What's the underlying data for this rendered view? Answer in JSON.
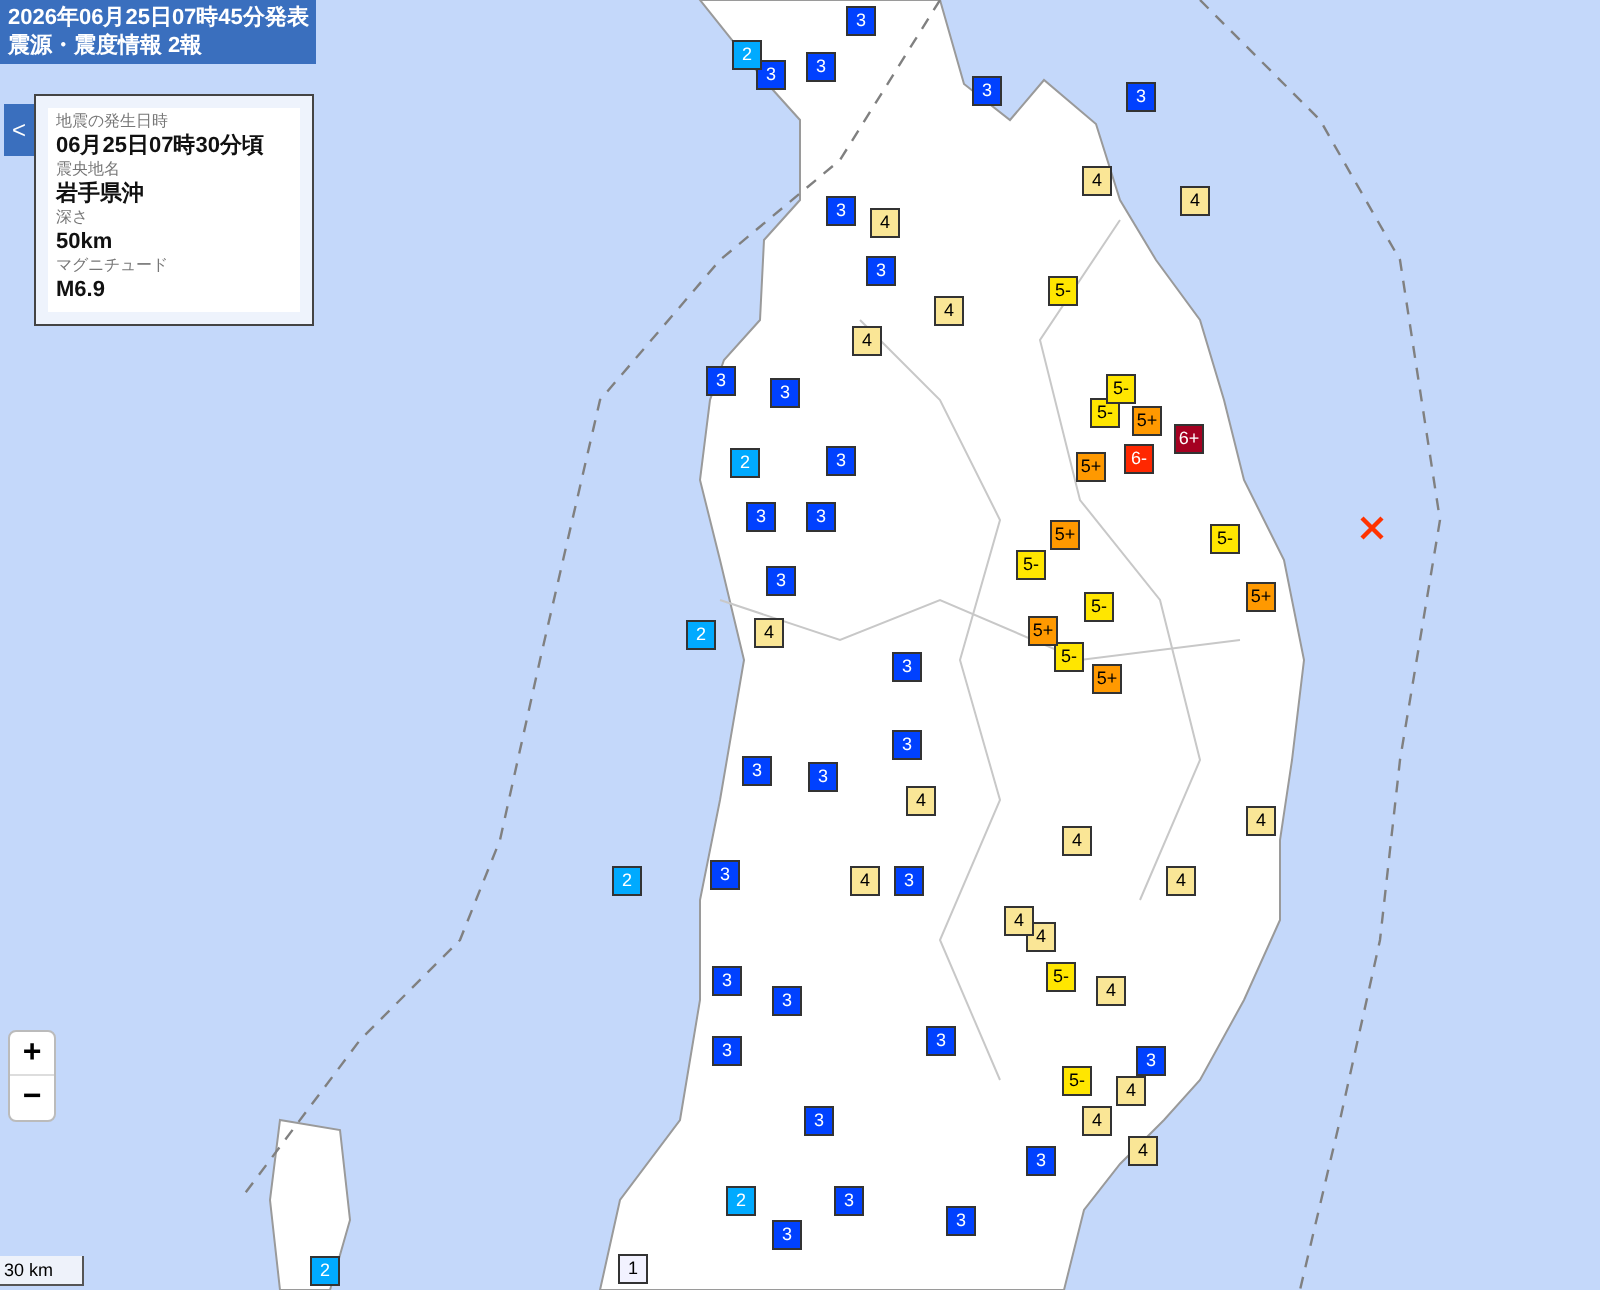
{
  "header": {
    "issued": "2026年06月25日07時45分発表",
    "title": "震源・震度情報 2報"
  },
  "info_panel": {
    "fields": [
      {
        "label": "地震の発生日時",
        "value": "06月25日07時30分頃"
      },
      {
        "label": "震央地名",
        "value": "岩手県沖"
      },
      {
        "label": "深さ",
        "value": "50km"
      },
      {
        "label": "マグニチュード",
        "value": "M6.9"
      }
    ]
  },
  "panel_toggle": "<",
  "zoom": {
    "in": "+",
    "out": "−"
  },
  "scale": "30 km",
  "stations": [
    {
      "intensity": "3",
      "color": "#0041ff"
    },
    {
      "intensity": "3",
      "color": "#0041ff"
    },
    {
      "intensity": "3",
      "color": "#0041ff"
    },
    {
      "intensity": "3",
      "color": "#0041ff"
    },
    {
      "intensity": "3",
      "color": "#0041ff"
    },
    {
      "intensity": "3",
      "color": "#0041ff"
    },
    {
      "intensity": "3",
      "color": "#0041ff"
    },
    {
      "intensity": "3",
      "color": "#0041ff"
    },
    {
      "intensity": "3",
      "color": "#0041ff"
    },
    {
      "intensity": "3",
      "color": "#0041ff"
    },
    {
      "intensity": "3",
      "color": "#0041ff"
    },
    {
      "intensity": "3",
      "color": "#0041ff"
    },
    {
      "intensity": "3",
      "color": "#0041ff"
    },
    {
      "intensity": "3",
      "color": "#0041ff"
    },
    {
      "intensity": "3",
      "color": "#0041ff"
    },
    {
      "intensity": "3",
      "color": "#0041ff"
    },
    {
      "intensity": "3",
      "color": "#0041ff"
    },
    {
      "intensity": "3",
      "color": "#0041ff"
    },
    {
      "intensity": "3",
      "color": "#0041ff"
    },
    {
      "intensity": "3",
      "color": "#0041ff"
    },
    {
      "intensity": "3",
      "color": "#0041ff"
    },
    {
      "intensity": "3",
      "color": "#0041ff"
    },
    {
      "intensity": "3",
      "color": "#0041ff"
    },
    {
      "intensity": "3",
      "color": "#0041ff"
    },
    {
      "intensity": "3",
      "color": "#0041ff"
    },
    {
      "intensity": "3",
      "color": "#0041ff"
    },
    {
      "intensity": "3",
      "color": "#0041ff"
    },
    {
      "intensity": "3",
      "color": "#0041ff"
    },
    {
      "intensity": "3",
      "color": "#0041ff"
    },
    {
      "intensity": "2",
      "color": "#00aaff"
    },
    {
      "intensity": "2",
      "color": "#00aaff"
    },
    {
      "intensity": "2",
      "color": "#00aaff"
    },
    {
      "intensity": "2",
      "color": "#00aaff"
    },
    {
      "intensity": "2",
      "color": "#00aaff"
    },
    {
      "intensity": "2",
      "color": "#00aaff"
    },
    {
      "intensity": "1",
      "color": "#f2f2ff"
    },
    {
      "intensity": "4",
      "color": "#fae696"
    },
    {
      "intensity": "4",
      "color": "#fae696"
    },
    {
      "intensity": "4",
      "color": "#fae696"
    },
    {
      "intensity": "4",
      "color": "#fae696"
    },
    {
      "intensity": "4",
      "color": "#fae696"
    },
    {
      "intensity": "4",
      "color": "#fae696"
    },
    {
      "intensity": "4",
      "color": "#fae696"
    },
    {
      "intensity": "4",
      "color": "#fae696"
    },
    {
      "intensity": "4",
      "color": "#fae696"
    },
    {
      "intensity": "4",
      "color": "#fae696"
    },
    {
      "intensity": "4",
      "color": "#fae696"
    },
    {
      "intensity": "4",
      "color": "#fae696"
    },
    {
      "intensity": "4",
      "color": "#fae696"
    },
    {
      "intensity": "4",
      "color": "#fae696"
    },
    {
      "intensity": "4",
      "color": "#fae696"
    },
    {
      "intensity": "4",
      "color": "#fae696"
    },
    {
      "intensity": "4",
      "color": "#fae696"
    },
    {
      "intensity": "5-",
      "color": "#ffe600"
    },
    {
      "intensity": "5-",
      "color": "#ffe600"
    },
    {
      "intensity": "5-",
      "color": "#ffe600"
    },
    {
      "intensity": "5-",
      "color": "#ffe600"
    },
    {
      "intensity": "5-",
      "color": "#ffe600"
    },
    {
      "intensity": "5-",
      "color": "#ffe600"
    },
    {
      "intensity": "5-",
      "color": "#ffe600"
    },
    {
      "intensity": "5-",
      "color": "#ffe600"
    },
    {
      "intensity": "5-",
      "color": "#ffe600"
    },
    {
      "intensity": "5+",
      "color": "#ff9900"
    },
    {
      "intensity": "5+",
      "color": "#ff9900"
    },
    {
      "intensity": "5+",
      "color": "#ff9900"
    },
    {
      "intensity": "5+",
      "color": "#ff9900"
    },
    {
      "intensity": "5+",
      "color": "#ff9900"
    },
    {
      "intensity": "5+",
      "color": "#ff9900"
    },
    {
      "intensity": "6-",
      "color": "#ff2800"
    },
    {
      "intensity": "6+",
      "color": "#a50021"
    }
  ]
}
